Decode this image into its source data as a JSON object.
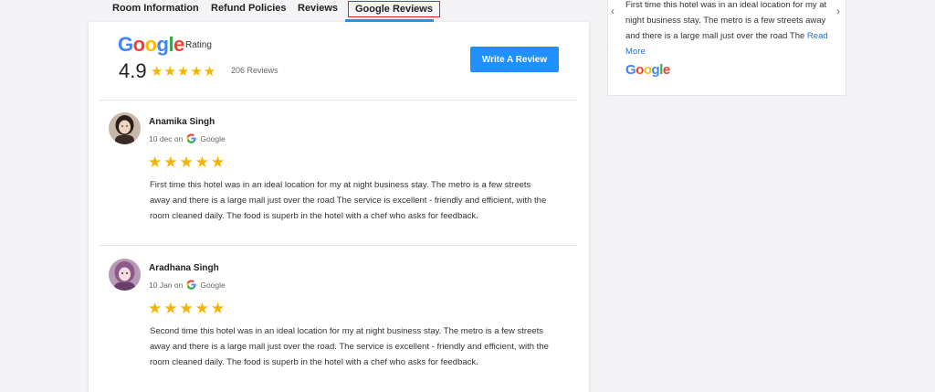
{
  "tabs": [
    {
      "label": "Room Information"
    },
    {
      "label": "Refund Policies"
    },
    {
      "label": "Reviews"
    },
    {
      "label": "Google Reviews",
      "active": true
    }
  ],
  "summary": {
    "brand": "Google",
    "rating_label": "Rating",
    "score": "4.9",
    "stars": 5,
    "review_count": "206 Reviews",
    "write_button": "Write A Review"
  },
  "reviews": [
    {
      "name": "Anamika Singh",
      "date": "10 dec on",
      "source": "Google",
      "stars": 5,
      "text": "First time this hotel was in an ideal location for my at night business stay. The metro is a few streets away and there is a large mall just over the road The service is excellent - friendly and efficient, with the room cleaned daily. The food is superb in the hotel with a chef who asks for feedback."
    },
    {
      "name": "Aradhana Singh",
      "date": "10 Jan on",
      "source": "Google",
      "stars": 5,
      "text": "Second time this hotel was in an ideal location for my at night business stay. The metro is a few streets away and there is a large mall just over the road. The service is excellent - friendly and efficient, with the room cleaned daily. The food is superb in the hotel with a chef who asks for feedback."
    }
  ],
  "side_card": {
    "text": "First time this hotel was in an ideal location for my at night business stay. The metro is a few streets away and there is a large mall just over the road The",
    "read_more": "Read More",
    "brand": "Google"
  },
  "colors": {
    "accent": "#1e90ff",
    "star": "#f4b400",
    "active_tab_border": "#e02424",
    "tab_underline": "#2196f3"
  }
}
